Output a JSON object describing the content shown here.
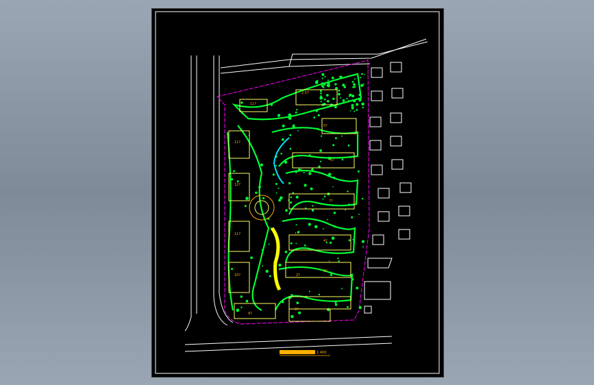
{
  "drawing": {
    "scale_label": "1:400",
    "plot_labels": {
      "b1": "2.5?",
      "b2": "11?",
      "b3": "11?",
      "b4": "12?",
      "b5": "11?",
      "b6": "10?",
      "b7": "9?",
      "b8": "8?",
      "b9": "5?",
      "b10": "6?",
      "b11": "7?",
      "b12": "4?",
      "b13": "3?",
      "b14": "1?",
      "b15": "2?"
    },
    "colors": {
      "background": "#000000",
      "frame": "#ffffff",
      "road": "#ffffff",
      "boundary": "#ff00ff",
      "building": "#ffff66",
      "planting": "#00ff33",
      "text": "#ffb000",
      "cyan": "#00e5ff"
    }
  }
}
